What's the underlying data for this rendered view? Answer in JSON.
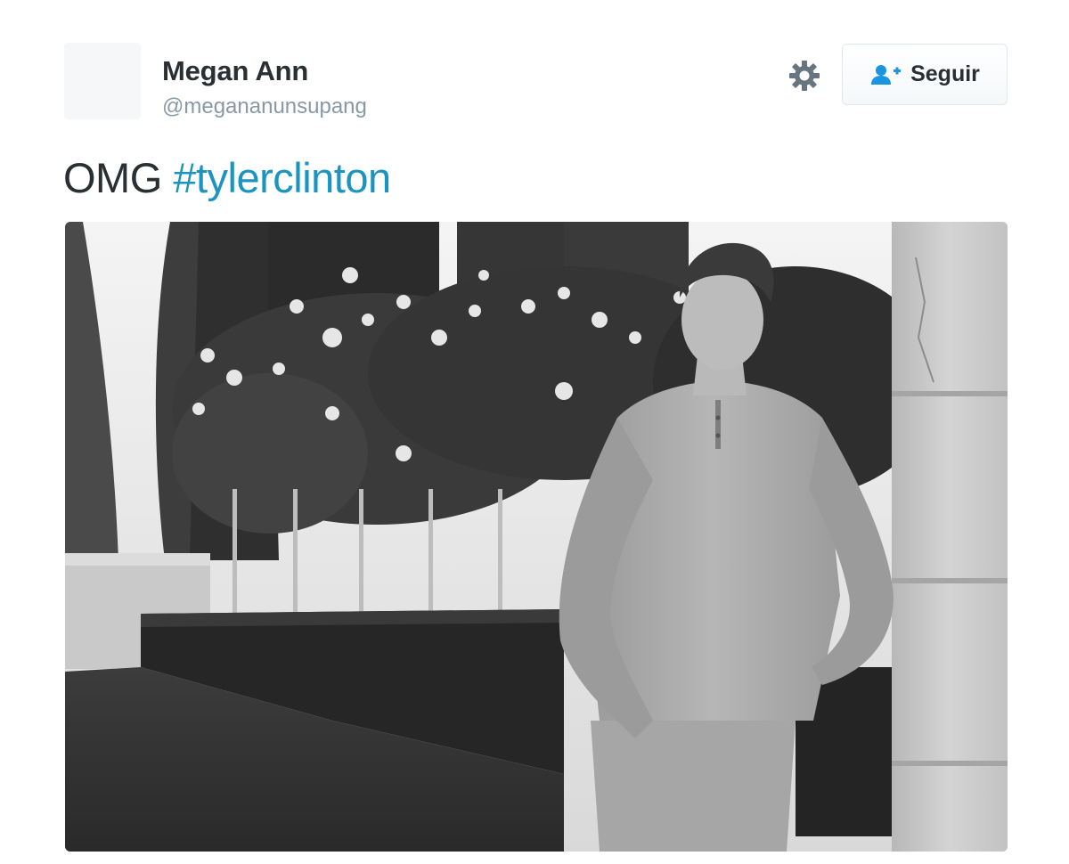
{
  "tweet": {
    "author_name": "Megan Ann",
    "author_handle": "@megananunsupang",
    "follow_label": "Seguir",
    "text_prefix": "OMG",
    "hashtag": "#tylerclinton",
    "settings_icon": "gear-icon",
    "follow_icon": "add-user-icon"
  },
  "colors": {
    "hashtag": "#1b95c0",
    "follow_icon": "#1b95e0",
    "settings_icon": "#66757f",
    "name": "#292f33",
    "handle": "#8899a6"
  }
}
